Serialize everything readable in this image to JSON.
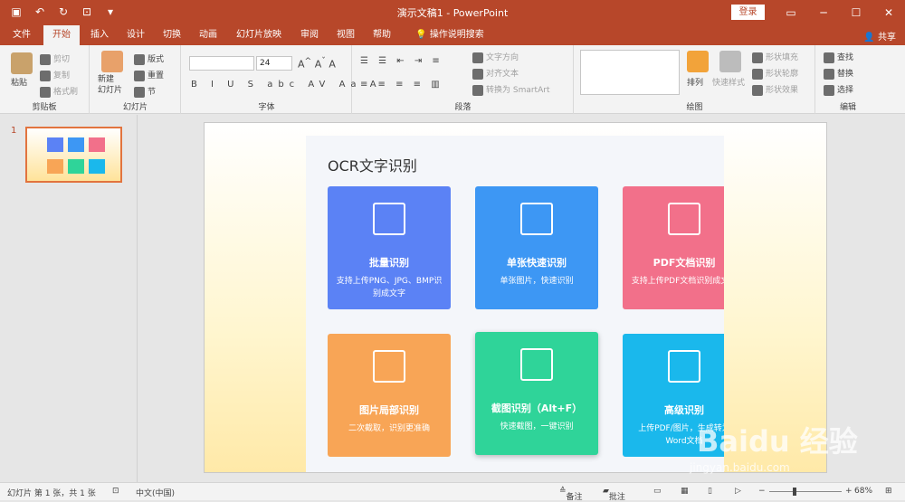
{
  "window": {
    "title": "演示文稿1  -  PowerPoint",
    "login_label": "登录"
  },
  "tabs": [
    "文件",
    "开始",
    "插入",
    "设计",
    "切换",
    "动画",
    "幻灯片放映",
    "审阅",
    "视图",
    "帮助",
    "操作说明搜索"
  ],
  "share_label": "共享",
  "ribbon": {
    "clipboard": {
      "paste": "粘贴",
      "cut": "剪切",
      "copy": "复制",
      "format_painter": "格式刷",
      "label": "剪贴板"
    },
    "slides": {
      "new_slide": "新建\n幻灯片",
      "layout": "版式",
      "reset": "重置",
      "section": "节",
      "label": "幻灯片"
    },
    "font": {
      "size": "24",
      "label": "字体"
    },
    "paragraph": {
      "text_direction": "文字方向",
      "align_text": "对齐文本",
      "smartart": "转换为 SmartArt",
      "label": "段落"
    },
    "drawing": {
      "arrange": "排列",
      "quick_styles": "快速样式",
      "shape_fill": "形状填充",
      "shape_outline": "形状轮廓",
      "shape_effects": "形状效果",
      "label": "绘图"
    },
    "editing": {
      "find": "查找",
      "replace": "替换",
      "select": "选择",
      "label": "编辑"
    }
  },
  "thumbnail": {
    "number": "1"
  },
  "slide": {
    "title": "OCR文字识别",
    "cards": [
      {
        "title": "批量识别",
        "desc": "支持上传PNG、JPG、BMP识别成文字",
        "color": "#5b82f5"
      },
      {
        "title": "单张快速识别",
        "desc": "单张图片，快速识别",
        "color": "#3d97f4"
      },
      {
        "title": "PDF文档识别",
        "desc": "支持上传PDF文档识别成文字",
        "color": "#f2708a"
      },
      {
        "title": "图片局部识别",
        "desc": "二次截取，识别更准确",
        "color": "#f8a556"
      },
      {
        "title": "截图识别（Alt+F）",
        "desc": "快速截图，一键识别",
        "color": "#2fd499"
      },
      {
        "title": "高级识别",
        "desc": "上传PDF/图片，生成转为Word文档",
        "color": "#1ab8ec"
      }
    ]
  },
  "status": {
    "slide_info": "幻灯片 第 1 张，共 1 张",
    "language": "中文(中国)",
    "notes": "备注",
    "comments": "批注",
    "zoom": "68%"
  },
  "watermark": {
    "brand": "Baidu 经验",
    "url": "jingyan.baidu.com"
  }
}
